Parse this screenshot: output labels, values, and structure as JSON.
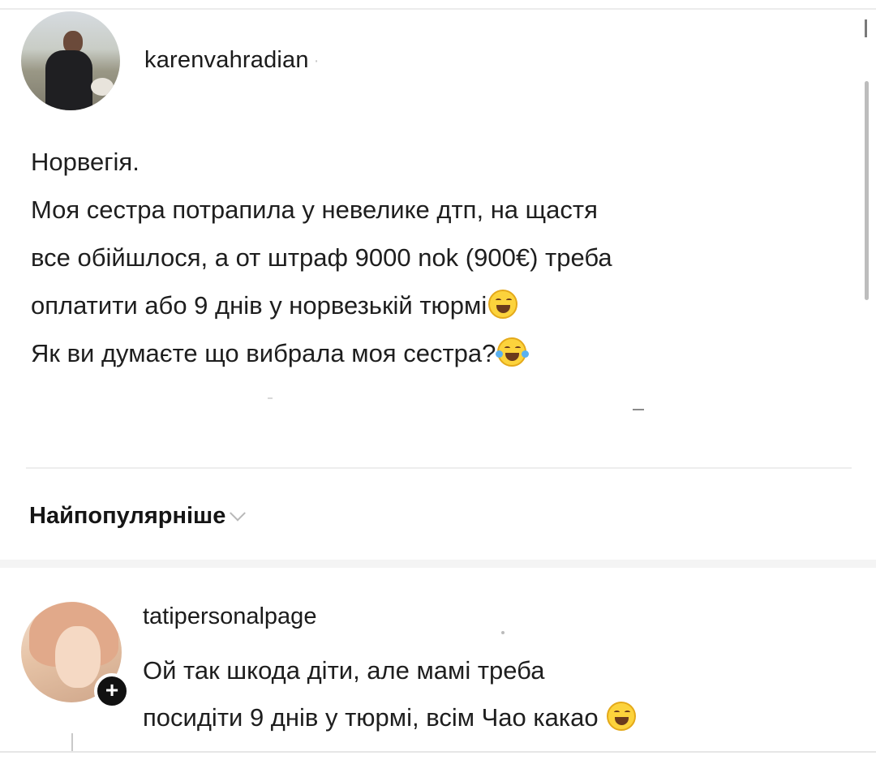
{
  "post": {
    "username": "karenvahradian",
    "username_suffix": "·",
    "lines": [
      "Норвегія.",
      "Моя сестра потрапила у невелике дтп, на щастя",
      "все обійшлося, а от штраф 9000 nok (900€) треба",
      "оплатити або 9 днів у норвезькій тюрмі",
      "Як ви думаєте що вибрала моя сестра?"
    ],
    "line4_emoji": "grinning-face-icon",
    "line5_emoji": "tears-of-joy-icon"
  },
  "comments_sort": {
    "label": "Найпопулярніше",
    "icon": "chevron-down-icon"
  },
  "comment": {
    "username": "tatipersonalpage",
    "lines": [
      "Ой так шкода діти, але мамі треба",
      "посидіти 9 днів у тюрмі, всім Чао какао"
    ],
    "emoji": "laughing-face-icon",
    "badge": "+"
  },
  "colors": {
    "emoji_yellow": "#fcd33c",
    "text": "#1e1e1e",
    "divider": "#ededed"
  }
}
